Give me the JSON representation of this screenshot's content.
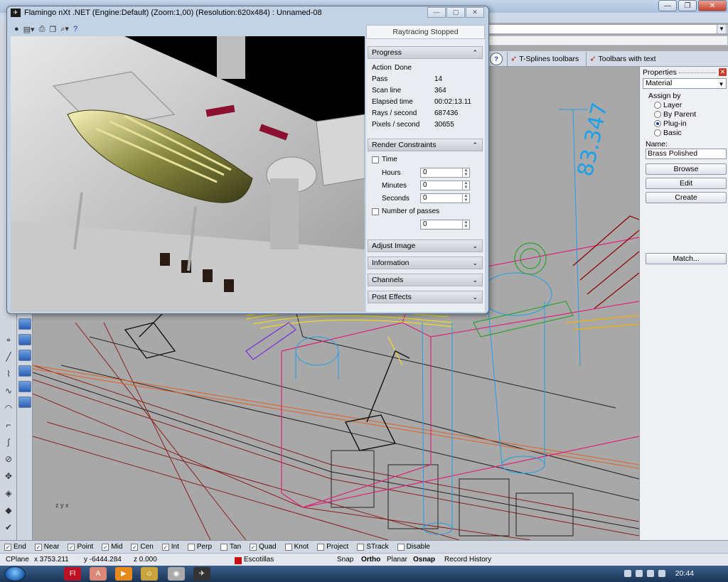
{
  "flamingo": {
    "title": "Flamingo nXt .NET (Engine:Default) (Zoom:1,00) (Resolution:620x484) : Unnamed-08",
    "status": "Raytracing Stopped",
    "progress": {
      "header": "Progress",
      "rows": [
        {
          "label": "Action",
          "value": "Done"
        },
        {
          "label": "Pass",
          "value": "14"
        },
        {
          "label": "Scan line",
          "value": "364"
        },
        {
          "label": "Elapsed time",
          "value": "00:02:13.11"
        },
        {
          "label": "Rays / second",
          "value": "687436"
        },
        {
          "label": "Pixels / second",
          "value": "30655"
        }
      ]
    },
    "render_constraints": {
      "header": "Render Constraints",
      "time_label": "Time",
      "hours_label": "Hours",
      "minutes_label": "Minutes",
      "seconds_label": "Seconds",
      "passes_label": "Number of passes",
      "hours": "0",
      "minutes": "0",
      "seconds": "0",
      "passes": "0"
    },
    "sections": [
      "Adjust Image",
      "Information",
      "Channels",
      "Post Effects"
    ]
  },
  "toolbar_tabs": [
    "T-Splines toolbars",
    "Toolbars with text"
  ],
  "viewport": {
    "dimension_text": "83.347"
  },
  "properties": {
    "title": "Properties",
    "category": "Material",
    "assign_by_label": "Assign by",
    "assign_options": [
      "Layer",
      "By Parent",
      "Plug-in",
      "Basic"
    ],
    "assign_selected": "Plug-in",
    "name_label": "Name:",
    "name_value": "Brass Polished",
    "buttons": [
      "Browse",
      "Edit",
      "Create",
      "Match..."
    ]
  },
  "osnap": {
    "items": [
      {
        "label": "End",
        "checked": true
      },
      {
        "label": "Near",
        "checked": true
      },
      {
        "label": "Point",
        "checked": true
      },
      {
        "label": "Mid",
        "checked": true
      },
      {
        "label": "Cen",
        "checked": true
      },
      {
        "label": "Int",
        "checked": true
      },
      {
        "label": "Perp",
        "checked": false
      },
      {
        "label": "Tan",
        "checked": false
      },
      {
        "label": "Quad",
        "checked": true
      },
      {
        "label": "Knot",
        "checked": false
      },
      {
        "label": "Project",
        "checked": false
      },
      {
        "label": "STrack",
        "checked": false
      },
      {
        "label": "Disable",
        "checked": false
      }
    ]
  },
  "statusbar": {
    "cplane": "CPlane",
    "x": "x 3753.211",
    "y": "y -6444.284",
    "z": "z 0.000",
    "layer": "Escotillas",
    "layer_color": "#c81010",
    "snap": "Snap",
    "ortho": "Ortho",
    "planar": "Planar",
    "osnap": "Osnap",
    "record_history": "Record History"
  },
  "taskbar": {
    "clock": "20:44"
  }
}
